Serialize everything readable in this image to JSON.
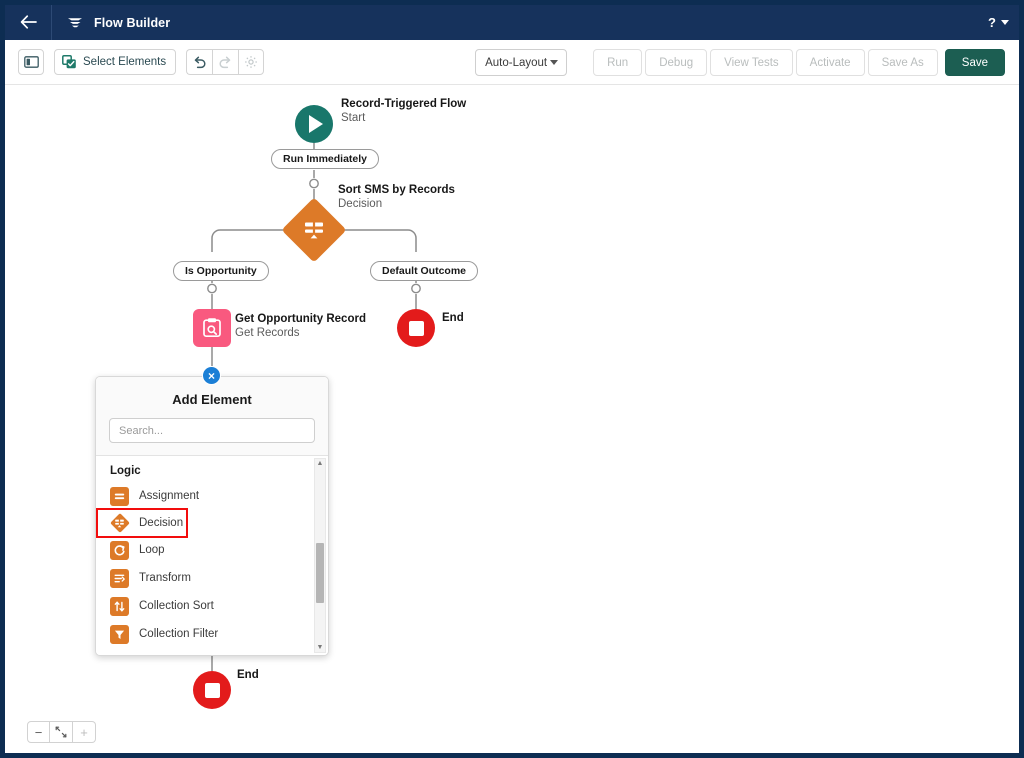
{
  "header": {
    "title": "Flow Builder",
    "back_icon": "arrow-left-icon",
    "logo_icon": "flow-logo-icon",
    "help_label": "?",
    "help_icon": "question-mark-icon"
  },
  "toolbar": {
    "panel_toggle_icon": "left-panel-toggle-icon",
    "select_elements_label": "Select Elements",
    "select_elements_icon": "select-elements-icon",
    "undo_icon": "undo-icon",
    "redo_icon": "redo-icon",
    "settings_icon": "gear-icon",
    "layout_mode": "Auto-Layout",
    "actions": [
      {
        "label": "Run",
        "disabled": true
      },
      {
        "label": "Debug",
        "disabled": true
      },
      {
        "label": "View Tests",
        "disabled": true
      },
      {
        "label": "Activate",
        "disabled": true
      },
      {
        "label": "Save As",
        "disabled": true
      }
    ],
    "save_label": "Save",
    "save_color": "#1c5e52"
  },
  "canvas": {
    "nodes": {
      "start": {
        "title": "Record-Triggered Flow",
        "subtitle": "Start",
        "color": "#19776b",
        "icon": "play-icon"
      },
      "decision": {
        "title": "Sort SMS by Records",
        "subtitle": "Decision",
        "color": "#dd7a28",
        "icon": "decision-diamond-icon"
      },
      "get_records": {
        "title": "Get Opportunity Record",
        "subtitle": "Get Records",
        "color": "#f9597f",
        "icon": "get-records-icon"
      },
      "end_right": {
        "title": "End",
        "color": "#e31b1b",
        "icon": "end-stop-icon"
      },
      "end_bottom": {
        "title": "End",
        "color": "#e31b1b",
        "icon": "end-stop-icon"
      }
    },
    "connector_labels": {
      "run_immediately": "Run Immediately",
      "is_opportunity": "Is Opportunity",
      "default_outcome": "Default Outcome"
    },
    "add_button_label": "×"
  },
  "popup": {
    "title": "Add Element",
    "close_icon": "close-x-icon",
    "search_placeholder": "Search...",
    "search_value": "",
    "section_label": "Logic",
    "highlight_color": "#f20d0d",
    "items": [
      {
        "label": "Assignment",
        "icon": "assignment-icon",
        "shape": "square",
        "highlighted": false
      },
      {
        "label": "Decision",
        "icon": "decision-icon",
        "shape": "diamond",
        "highlighted": true
      },
      {
        "label": "Loop",
        "icon": "loop-icon",
        "shape": "square",
        "highlighted": false
      },
      {
        "label": "Transform",
        "icon": "transform-icon",
        "shape": "square",
        "highlighted": false
      },
      {
        "label": "Collection Sort",
        "icon": "collection-sort-icon",
        "shape": "square",
        "highlighted": false
      },
      {
        "label": "Collection Filter",
        "icon": "collection-filter-icon",
        "shape": "square",
        "highlighted": false
      }
    ],
    "scroll_up_icon": "scroll-up-arrow-icon",
    "scroll_down_icon": "scroll-down-arrow-icon"
  },
  "zoom_controls": {
    "zoom_out_label": "−",
    "fit_icon": "fit-to-view-icon",
    "zoom_in_label": "+"
  }
}
